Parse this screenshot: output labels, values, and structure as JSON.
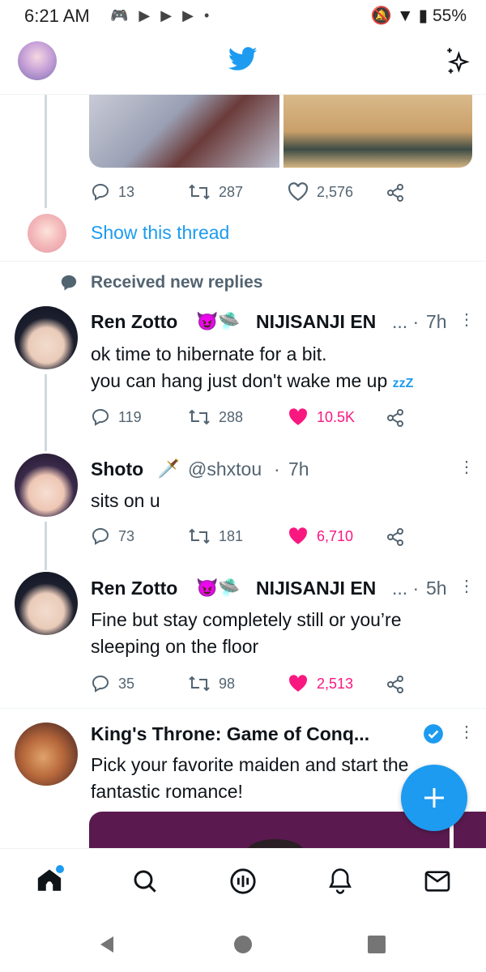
{
  "status_bar": {
    "time": "6:21 AM",
    "battery": "55%"
  },
  "prev_tweet": {
    "replies": "13",
    "retweets": "287",
    "likes": "2,576",
    "show_thread": "Show this thread"
  },
  "section_label": "Received new replies",
  "tweets": [
    {
      "name": "Ren Zotto",
      "emojis": "😈🛸",
      "display_extra": "NIJISANJI EN",
      "time": "7h",
      "text_line1": "ok time to hibernate for a bit.",
      "text_line2": "you can hang just don't wake me up",
      "zzz": "zzZ",
      "replies": "119",
      "retweets": "288",
      "likes": "10.5K",
      "liked": true
    },
    {
      "name": "Shoto",
      "emojis": "🗡️",
      "handle": "@shxtou",
      "time": "7h",
      "text_line1": "sits on u",
      "replies": "73",
      "retweets": "181",
      "likes": "6,710",
      "liked": true
    },
    {
      "name": "Ren Zotto",
      "emojis": "😈🛸",
      "display_extra": "NIJISANJI EN",
      "time": "5h",
      "text_line1": "Fine but stay completely still or you’re",
      "text_line2": "sleeping on the floor",
      "replies": "35",
      "retweets": "98",
      "likes": "2,513",
      "liked": true
    }
  ],
  "promoted": {
    "name": "King's Throne: Game of Conq...",
    "text_line1": "Pick your favorite maiden and start the",
    "text_line2": "fantastic romance!"
  },
  "colors": {
    "brand": "#1d9bf0",
    "like": "#f91880",
    "text": "#0f1419",
    "muted": "#536471",
    "promo_bg": "#5a1a4f"
  },
  "icons": [
    "twitter-bird-icon",
    "sparkle-icon",
    "reply-icon",
    "retweet-icon",
    "like-icon",
    "share-icon",
    "home-icon",
    "search-icon",
    "spaces-icon",
    "notifications-icon",
    "messages-icon",
    "compose-icon"
  ]
}
